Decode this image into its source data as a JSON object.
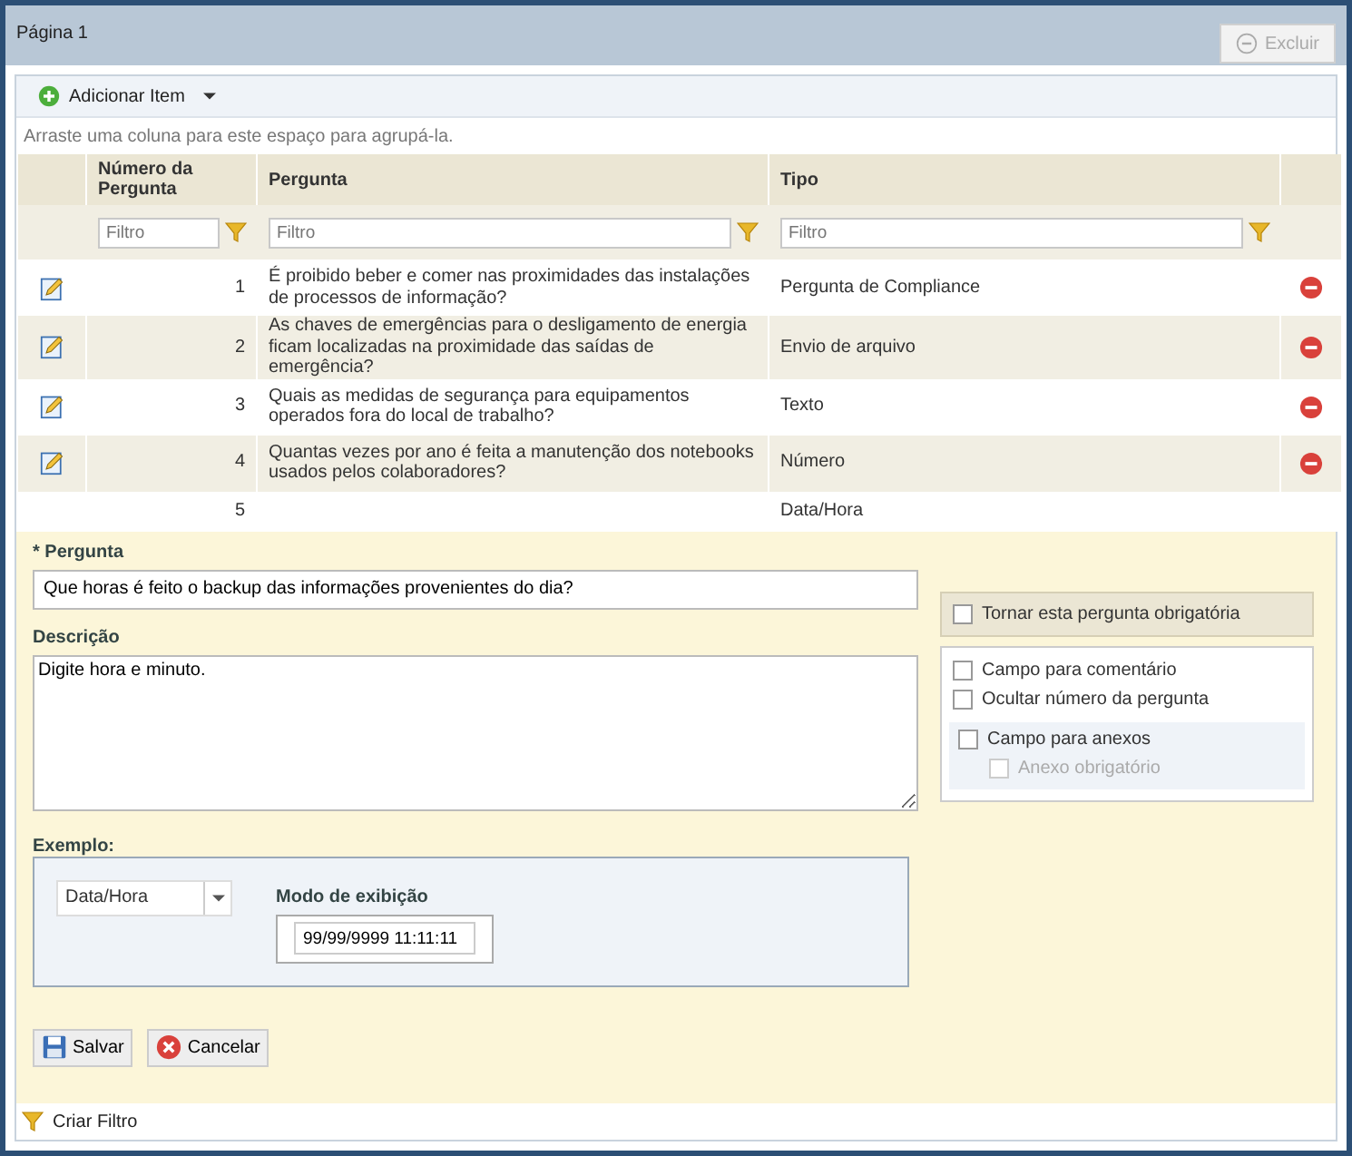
{
  "page": {
    "title": "Página 1",
    "delete_button": {
      "label": "Excluir",
      "disabled": true
    }
  },
  "toolbar": {
    "add_item": "Adicionar Item"
  },
  "group_panel": "Arraste uma coluna para este espaço para agrupá-la.",
  "table": {
    "columns": [
      "Número da Pergunta",
      "Pergunta",
      "Tipo"
    ],
    "filters": [
      {
        "placeholder": "Filtro"
      },
      {
        "placeholder": "Filtro"
      },
      {
        "placeholder": "Filtro"
      }
    ],
    "rows": [
      {
        "number": "1",
        "question": "É proibido beber e comer nas proximidades das instalações de processos de informação?",
        "type": "Pergunta de Compliance",
        "editing": false
      },
      {
        "number": "2",
        "question": "As chaves de emergências para o desligamento de energia ficam localizadas na proximidade das saídas de emergência?",
        "type": "Envio de arquivo",
        "editing": false
      },
      {
        "number": "3",
        "question": "Quais as medidas de segurança para equipamentos operados fora do local de trabalho?",
        "type": "Texto",
        "editing": false
      },
      {
        "number": "4",
        "question": "Quantas vezes por ano é feita a manutenção dos notebooks usados pelos colaboradores?",
        "type": "Número",
        "editing": false
      },
      {
        "number": "5",
        "question": "",
        "type": "Data/Hora",
        "editing": true
      }
    ]
  },
  "editor": {
    "question_label": "* Pergunta",
    "question_value": "Que horas é feito o backup das informações provenientes do dia?",
    "description_label": "Descrição",
    "description_value": "Digite hora e minuto.",
    "required": {
      "label": "Tornar esta pergunta obrigatória",
      "checked": false
    },
    "options": [
      {
        "label": "Campo para comentário",
        "checked": false
      },
      {
        "label": "Ocultar número da pergunta",
        "checked": false
      }
    ],
    "attachments": {
      "label": "Campo para anexos",
      "checked": false,
      "sub": {
        "label": "Anexo obrigatório",
        "checked": false,
        "disabled": true
      }
    },
    "example_label": "Exemplo:",
    "type_select": "Data/Hora",
    "display_mode_label": "Modo de exibição",
    "display_mode_value": "99/99/9999 11:11:11",
    "buttons": [
      {
        "kind": "save",
        "label": "Salvar"
      },
      {
        "kind": "cancel",
        "label": "Cancelar"
      }
    ]
  },
  "footer": {
    "create_filter": "Criar Filtro"
  }
}
